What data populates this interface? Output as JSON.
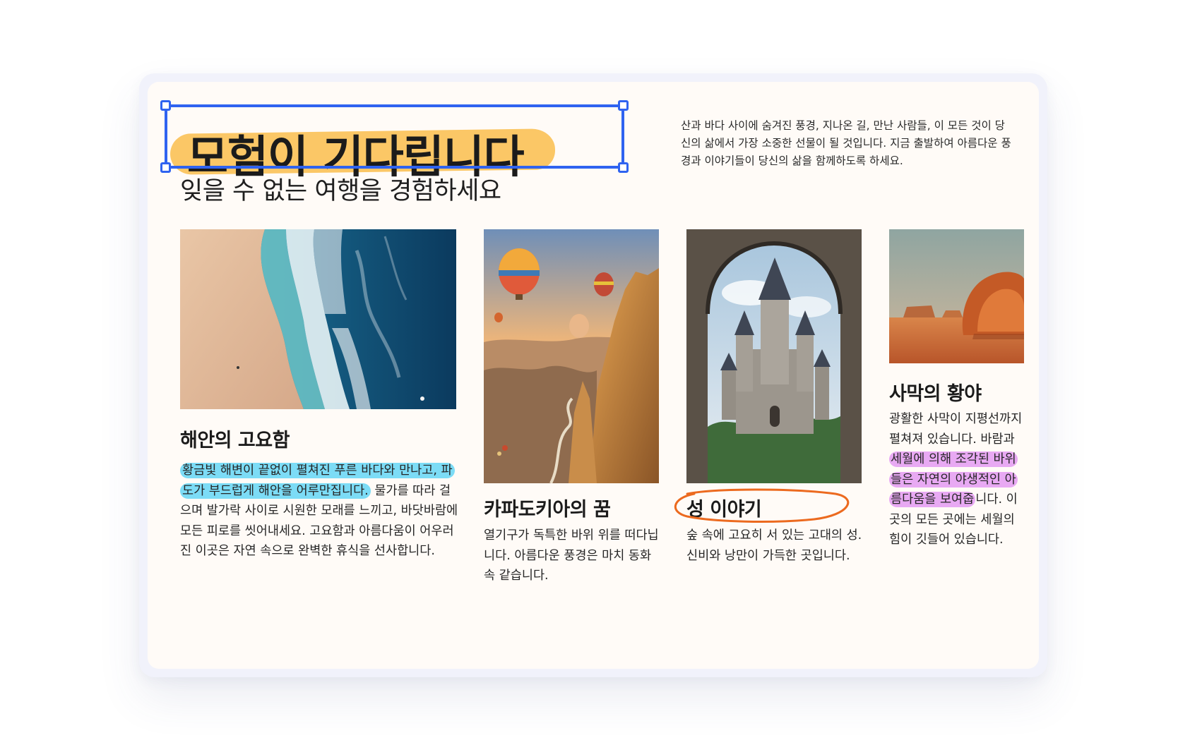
{
  "hero": {
    "title": "모험이 기다립니다",
    "subtitle": "잊을 수 없는 여행을 경험하세요",
    "intro": "산과 바다 사이에 숨겨진 풍경, 지나온 길, 만난 사람들, 이 모든 것이 당신의 삶에서 가장 소중한 선물이 될 것입니다. 지금 출발하여 아름다운 풍경과 이야기들이 당신의 삶을 함께하도록 하세요."
  },
  "cards": [
    {
      "title": "해안의 고요함",
      "highlight": "황금빛 해변이 끝없이 펼쳐진 푸른 바다와 만나고, 파도가 부드럽게 해안을 어루만집니다.",
      "body": " 물가를 따라 걸으며 발가락 사이로 시원한 모래를 느끼고, 바닷바람에 모든 피로를 씻어내세요. 고요함과 아름다움이 어우러진 이곳은 자연 속으로 완벽한 휴식을 선사합니다.",
      "image": "aerial-beach-waves"
    },
    {
      "title": "카파도키아의 꿈",
      "body": "열기구가 독특한 바위 위를 떠다닙니다. 아름다운 풍경은 마치 동화 속 같습니다.",
      "image": "hot-air-balloons-rock-formations"
    },
    {
      "title": "성 이야기",
      "body": "숲 속에 고요히 서 있는 고대의 성. 신비와 낭만이 가득한 곳입니다.",
      "image": "castle-through-stone-arch"
    },
    {
      "title": "사막의 황야",
      "body_before": "광활한 사막이 지평선까지 펼쳐져 있습니다. 바람과 ",
      "highlight": "세월에 의해 조각된 바위들은 자연의 야생적인 아름다움을 보여줍",
      "body_after": "니다. 이곳의 모든 곳에는 세월의 힘이 깃들어 있습니다.",
      "image": "desert-red-rocks"
    }
  ],
  "colors": {
    "title_highlight": "#fbc766",
    "selection": "#2f63f0",
    "blue_highlight": "#7cdcf6",
    "purple_highlight": "#e8a9f3",
    "circle_annotation": "#ec6a1f"
  }
}
